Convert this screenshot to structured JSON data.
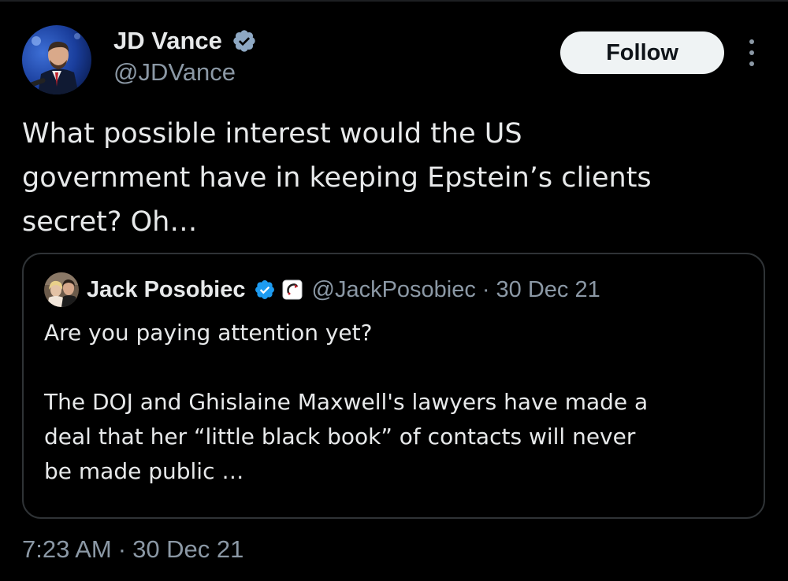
{
  "author": {
    "name": "JD Vance",
    "handle": "@JDVance",
    "verified_color": "#1d9bf0"
  },
  "actions": {
    "follow_label": "Follow",
    "more_icon": "more-vertical-icon"
  },
  "tweet": {
    "text": "What possible interest would the US\ngovernment have in keeping Epstein’s clients\nsecret? Oh…",
    "time": "7:23 AM",
    "separator": "·",
    "date": "30 Dec 21"
  },
  "quoted_tweet": {
    "author_name": "Jack Posobiec",
    "handle": "@JackPosobiec",
    "separator": "·",
    "date": "30 Dec 21",
    "affiliate_icon": "affiliate-badge-icon",
    "text": "Are you paying attention yet?\n\nThe DOJ and Ghislaine Maxwell's lawyers have made a\ndeal that her “little black book” of contacts will never\nbe made public …"
  },
  "colors": {
    "background": "#000000",
    "text_primary": "#e7e9ea",
    "text_secondary": "#8b98a5",
    "border": "#2f3336",
    "verified": "#1d9bf0",
    "button_bg": "#eff3f4"
  }
}
